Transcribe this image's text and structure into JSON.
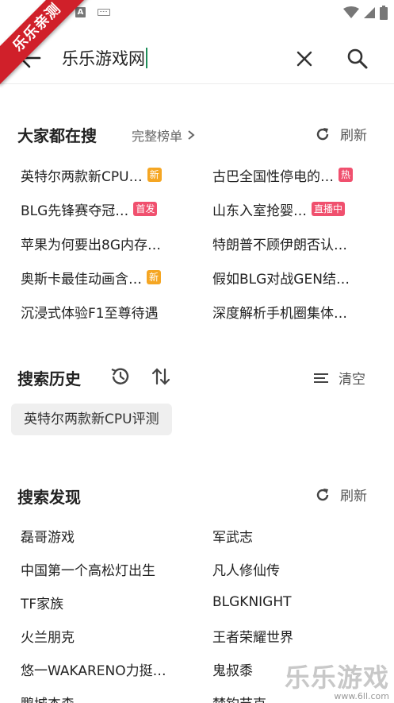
{
  "watermark": {
    "ribbon_text": "乐乐亲测",
    "bottom_text": "乐乐游戏",
    "bottom_url": "www.6ll.com"
  },
  "search": {
    "query": "乐乐游戏网"
  },
  "hot": {
    "title": "大家都在搜",
    "full_list_label": "完整榜单",
    "refresh_label": "刷新",
    "items": [
      {
        "text": "英特尔两款新CPU…",
        "badge": "新",
        "badge_color": "#f5a623"
      },
      {
        "text": "古巴全国性停电的…",
        "badge": "热",
        "badge_color": "#f0506e"
      },
      {
        "text": "BLG先锋赛夺冠…",
        "badge": "首发",
        "badge_color": "#f0506e"
      },
      {
        "text": "山东入室抢婴…",
        "badge": "直播中",
        "badge_color": "#f0506e"
      },
      {
        "text": "苹果为何要出8G内存…",
        "badge": "",
        "badge_color": ""
      },
      {
        "text": "特朗普不顾伊朗否认…",
        "badge": "",
        "badge_color": ""
      },
      {
        "text": "奥斯卡最佳动画含…",
        "badge": "新",
        "badge_color": "#f5a623"
      },
      {
        "text": "假如BLG对战GEN结…",
        "badge": "",
        "badge_color": ""
      },
      {
        "text": "沉浸式体验F1至尊待遇",
        "badge": "",
        "badge_color": ""
      },
      {
        "text": "深度解析手机圈集体…",
        "badge": "",
        "badge_color": ""
      }
    ]
  },
  "history": {
    "title": "搜索历史",
    "clear_label": "清空",
    "items": [
      "英特尔两款新CPU评测"
    ]
  },
  "discover": {
    "title": "搜索发现",
    "refresh_label": "刷新",
    "items": [
      "磊哥游戏",
      "军武志",
      "中国第一个高松灯出生",
      "凡人修仙传",
      "TF家族",
      "BLGKNIGHT",
      "火兰朋克",
      "王者荣耀世界",
      "悠一WAKARENO力挺…",
      "鬼叔黍",
      "鹏城杰森",
      "梦钓节克"
    ]
  }
}
